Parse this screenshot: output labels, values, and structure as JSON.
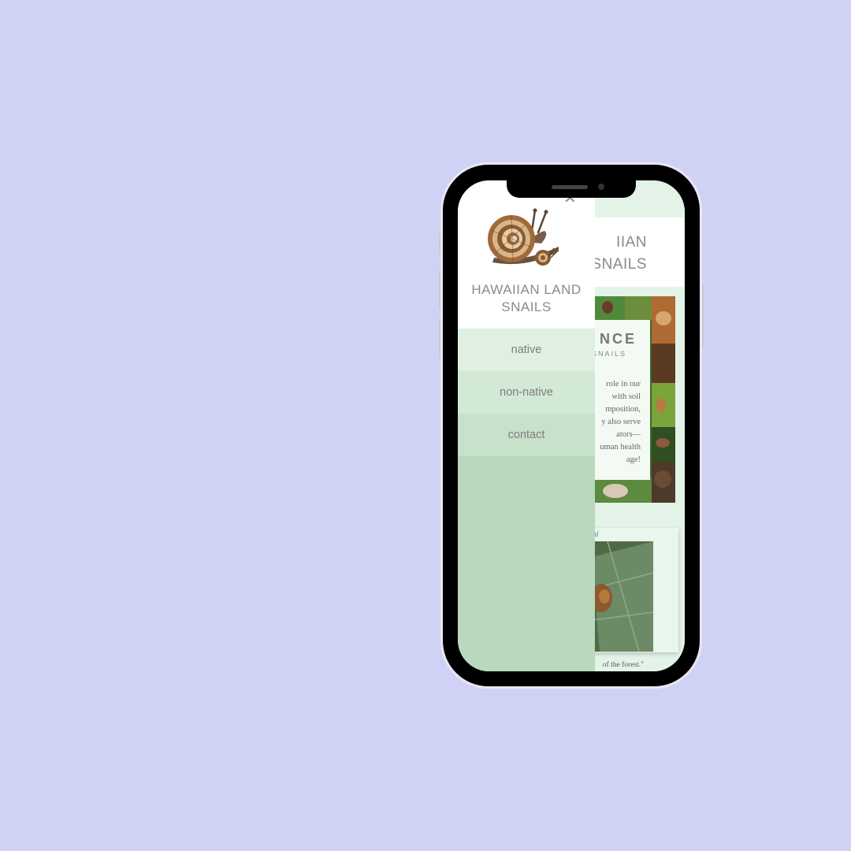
{
  "drawer": {
    "brand": "HAWAIIAN LAND SNAILS",
    "close_icon": "close-icon",
    "items": [
      {
        "label": "native"
      },
      {
        "label": "non-native"
      },
      {
        "label": "contact"
      }
    ]
  },
  "background_page": {
    "title_line1": "IIAN",
    "title_line2": "SNAILS",
    "card": {
      "heading": "NCE",
      "sub": "SNAILS",
      "body_lines": [
        "role in our",
        "with soil",
        "mposition,",
        "y also serve",
        "ators—",
        "uman health",
        "age!"
      ]
    },
    "feature_label": "ui",
    "quote": "of the forest.\""
  },
  "colors": {
    "backdrop": "#d0d2f5",
    "drawer": "#b9d8bd",
    "page_green": "#e4f3e7"
  }
}
